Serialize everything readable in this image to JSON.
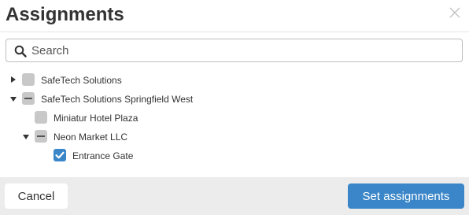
{
  "dialog": {
    "title": "Assignments",
    "close_icon": "close-icon"
  },
  "search": {
    "placeholder": "Search",
    "value": "",
    "icon": "search-icon"
  },
  "tree": [
    {
      "label": "SafeTech Solutions",
      "state": "unchecked",
      "expanded": false
    },
    {
      "label": "SafeTech Solutions Springfield West",
      "state": "indeterminate",
      "expanded": true
    },
    {
      "label": "Miniatur Hotel Plaza",
      "state": "unchecked"
    },
    {
      "label": "Neon Market LLC",
      "state": "indeterminate",
      "expanded": true
    },
    {
      "label": "Entrance Gate",
      "state": "checked"
    }
  ],
  "footer": {
    "cancel_label": "Cancel",
    "set_label": "Set assignments"
  },
  "colors": {
    "accent": "#3a86c8",
    "checkbox_unchecked": "#c8c8c8",
    "footer_bg": "#ececec"
  }
}
